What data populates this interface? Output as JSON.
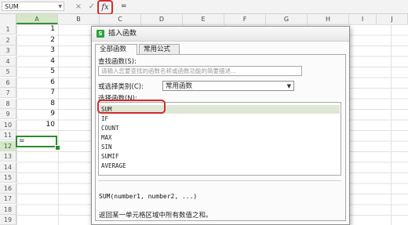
{
  "formula_bar": {
    "name_box": "SUM",
    "cancel_icon": "×",
    "enter_icon": "✓",
    "fx_label": "fx",
    "formula": "="
  },
  "columns": [
    "A",
    "B",
    "C",
    "D",
    "E",
    "F",
    "G",
    "H",
    "I",
    "J"
  ],
  "rows": [
    "1",
    "2",
    "3",
    "4",
    "5",
    "6",
    "7",
    "8",
    "9",
    "10",
    "11",
    "12",
    "13",
    "14",
    "15",
    "16",
    "17",
    "18",
    "19"
  ],
  "cells": {
    "a_values": [
      "1",
      "2",
      "3",
      "4",
      "5",
      "6",
      "7",
      "8",
      "9",
      "10"
    ],
    "active_cell_value": "="
  },
  "dialog": {
    "logo": "S",
    "title": "插入函数",
    "tabs": [
      "全部函数",
      "常用公式"
    ],
    "search_label": "查找函数(S):",
    "search_placeholder": "请输入您要查找的函数名称或函数功能的简要描述...",
    "category_label": "或选择类别(C):",
    "category_value": "常用函数",
    "functions_label": "选择函数(N):",
    "functions": [
      "SUM",
      "IF",
      "COUNT",
      "MAX",
      "SIN",
      "SUMIF",
      "AVERAGE"
    ],
    "selected_function": "SUM",
    "signature": "SUM(number1, number2, ...)",
    "description": "返回某一单元格区域中所有数值之和。"
  },
  "colors": {
    "accent_green": "#2f8a2f",
    "highlight_red": "#d42a2a"
  }
}
